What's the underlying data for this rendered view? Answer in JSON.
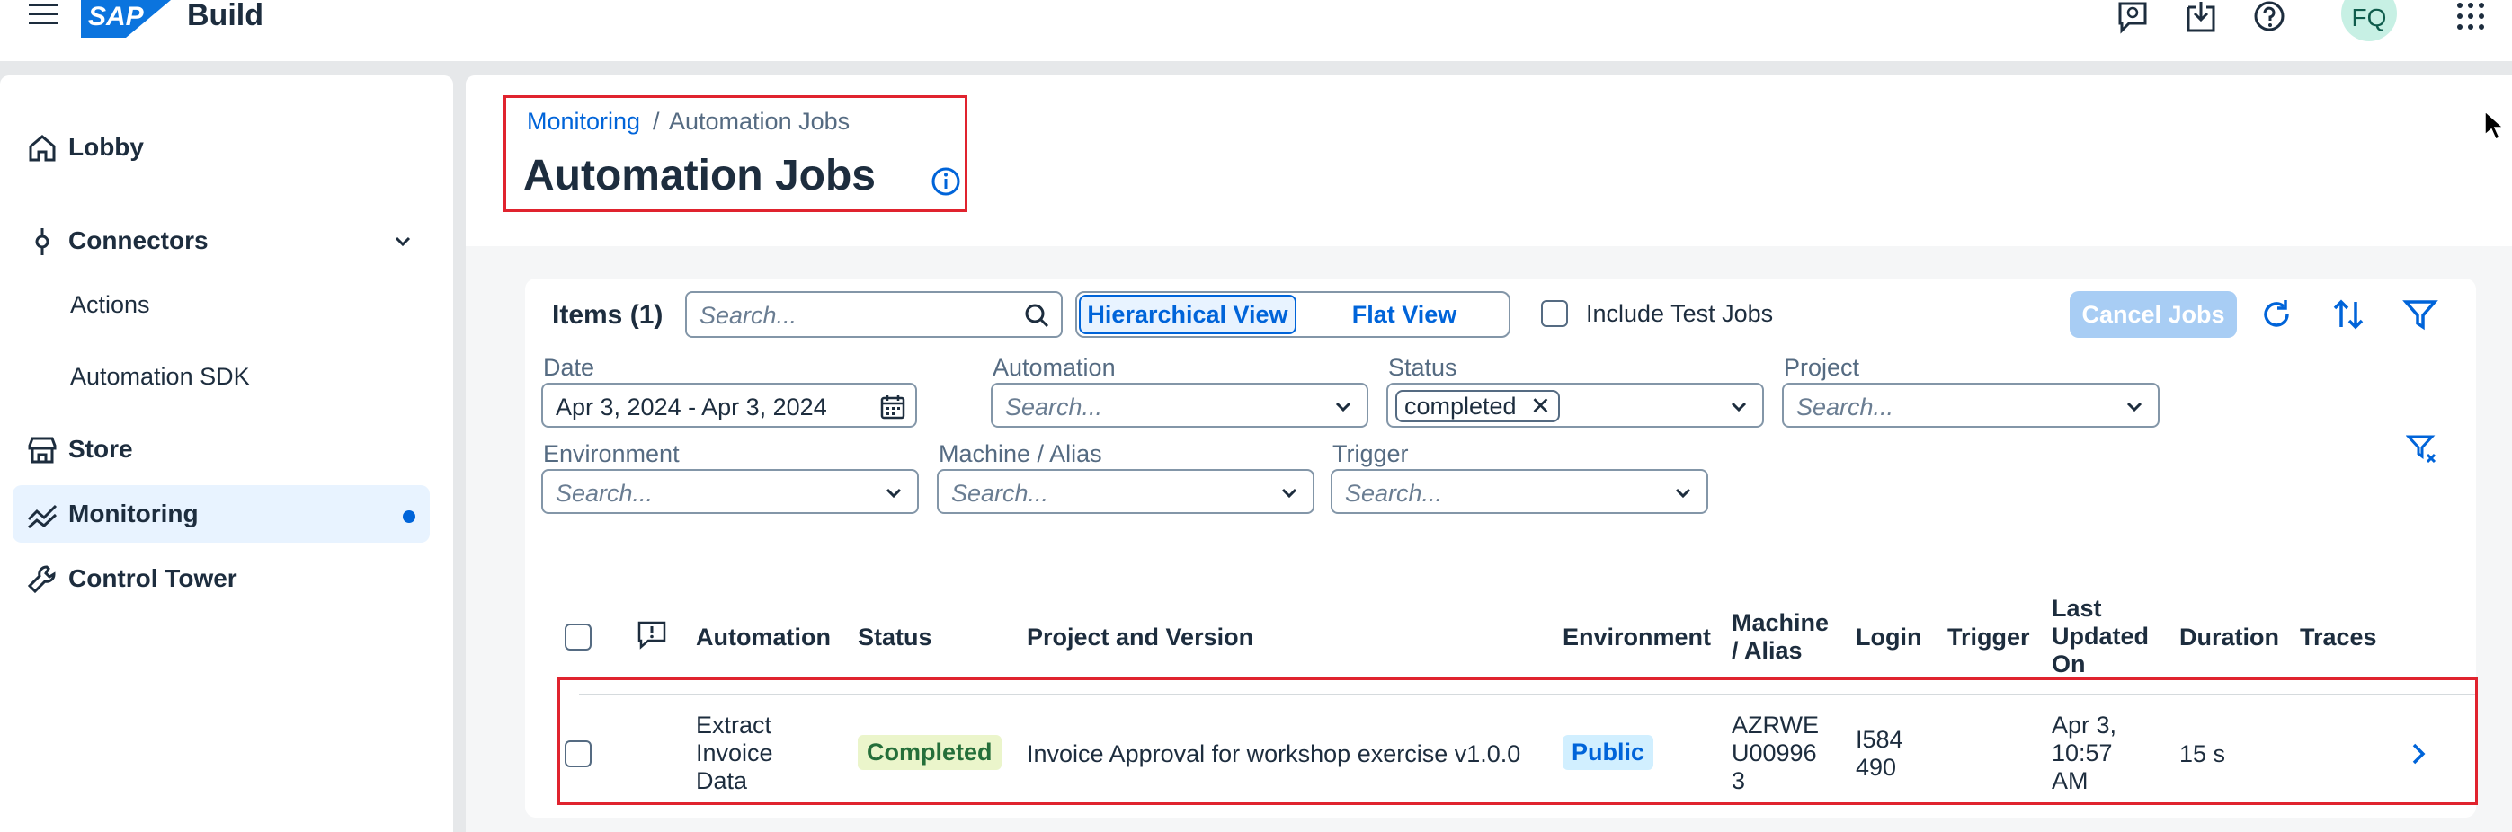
{
  "shell": {
    "product_name": "Build",
    "logo_text": "SAP",
    "avatar_initials": "FQ",
    "icons": [
      "menu-icon",
      "feedback-icon",
      "downloads-icon",
      "help-icon",
      "apps-grid-icon"
    ]
  },
  "sidebar": {
    "items": [
      {
        "label": "Lobby",
        "icon": "home-icon"
      },
      {
        "label": "Connectors",
        "icon": "connector-icon",
        "expanded": true
      },
      {
        "label": "Actions",
        "sub": true
      },
      {
        "label": "Automation SDK",
        "sub": true
      },
      {
        "label": "Store",
        "icon": "store-icon"
      },
      {
        "label": "Monitoring",
        "icon": "line-chart-icon",
        "selected": true
      },
      {
        "label": "Control Tower",
        "icon": "wrench-icon"
      }
    ]
  },
  "breadcrumb": {
    "parent": "Monitoring",
    "separator": "/",
    "current": "Automation Jobs"
  },
  "page": {
    "title": "Automation Jobs"
  },
  "toolbar": {
    "items_label": "Items (1)",
    "search_placeholder": "Search...",
    "view_hierarchical": "Hierarchical View",
    "view_flat": "Flat View",
    "include_test_jobs": "Include Test Jobs",
    "cancel_jobs": "Cancel Jobs"
  },
  "filters": {
    "date": {
      "label": "Date",
      "value": "Apr 3, 2024 - Apr 3, 2024"
    },
    "automation": {
      "label": "Automation",
      "placeholder": "Search..."
    },
    "status": {
      "label": "Status",
      "token": "completed"
    },
    "project": {
      "label": "Project",
      "placeholder": "Search..."
    },
    "environment": {
      "label": "Environment",
      "placeholder": "Search..."
    },
    "machine": {
      "label": "Machine / Alias",
      "placeholder": "Search..."
    },
    "trigger": {
      "label": "Trigger",
      "placeholder": "Search..."
    }
  },
  "table": {
    "columns": {
      "automation": "Automation",
      "status": "Status",
      "project": "Project and Version",
      "environment": "Environment",
      "machine_l1": "Machine",
      "machine_l2": "/ Alias",
      "login": "Login",
      "trigger": "Trigger",
      "updated_l1": "Last",
      "updated_l2": "Updated",
      "updated_l3": "On",
      "duration": "Duration",
      "traces": "Traces"
    },
    "rows": [
      {
        "automation_l1": "Extract",
        "automation_l2": "Invoice",
        "automation_l3": "Data",
        "status": "Completed",
        "project": "Invoice Approval for workshop exercise v1.0.0",
        "environment": "Public",
        "machine_l1": "AZRWE",
        "machine_l2": "U00996",
        "machine_l3": "3",
        "login_l1": "I584",
        "login_l2": "490",
        "updated_l1": "Apr 3,",
        "updated_l2": "10:57",
        "updated_l3": "AM",
        "duration": "15 s"
      }
    ]
  },
  "colors": {
    "accent": "#0064d9",
    "highlight": "#e0232e",
    "completed_bg": "#ebf5cb",
    "public_bg": "#d1efff"
  }
}
